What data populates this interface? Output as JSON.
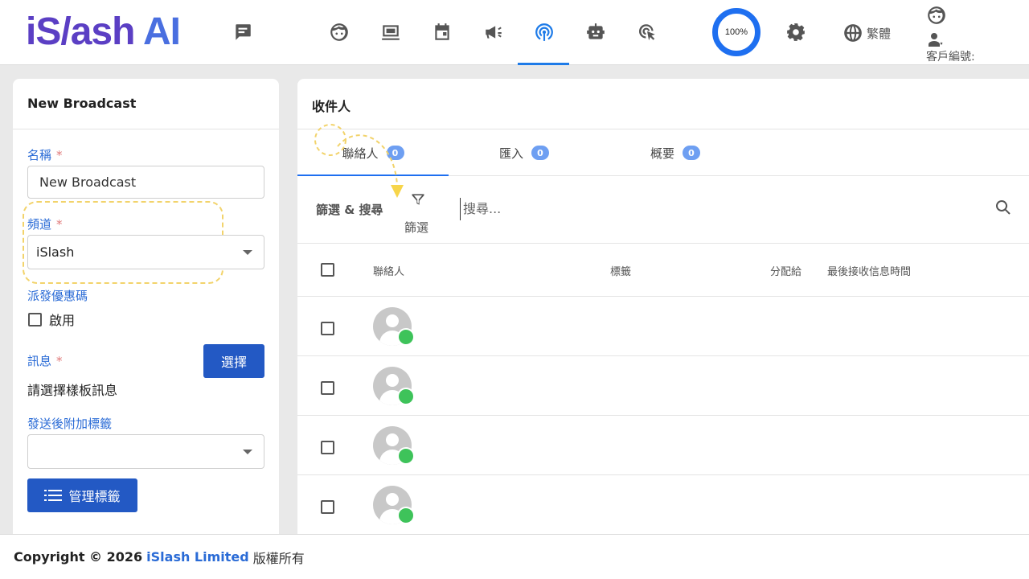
{
  "brand": {
    "logo_part1": "iS/ash",
    "logo_part2": " AI"
  },
  "nav": {
    "icons": [
      "chat-icon",
      "face-icon",
      "inbox-icon",
      "calendar-icon",
      "megaphone-icon",
      "broadcast-icon",
      "robot-icon",
      "click-icon"
    ],
    "active": "broadcast-icon",
    "progress_label": "100%",
    "language_label": "繁體",
    "client_id_label": "客戶編號:"
  },
  "left": {
    "title": "New Broadcast",
    "name_label": "名稱",
    "required_mark": "*",
    "name_value": "New Broadcast",
    "channel_label": "頻道",
    "channel_value": "iSlash",
    "coupon_label": "派發優惠碼",
    "enable_label": "啟用",
    "message_label": "訊息",
    "select_button": "選擇",
    "message_hint": "請選擇樣板訊息",
    "tag_label": "發送後附加標籤",
    "manage_tags_button": "管理標籤"
  },
  "right": {
    "title": "收件人",
    "tabs": [
      {
        "label": "聯絡人",
        "count": "0"
      },
      {
        "label": "匯入",
        "count": "0"
      },
      {
        "label": "概要",
        "count": "0"
      }
    ],
    "filter_label": "篩選 & 搜尋",
    "filter_button": "篩選",
    "search_placeholder": "搜尋...",
    "columns": {
      "contact": "聯絡人",
      "tags": "標籤",
      "assigned": "分配給",
      "last_received": "最後接收信息時間"
    }
  },
  "footer": {
    "copyright": "Copyright © 2026",
    "company": "iSlash Limited",
    "rights": "版權所有"
  },
  "colors": {
    "primary": "#2359c4",
    "accent": "#1e6ff0",
    "label_blue": "#2a6bd6",
    "highlight": "#f2d36b",
    "whatsapp": "#3ec35a"
  }
}
